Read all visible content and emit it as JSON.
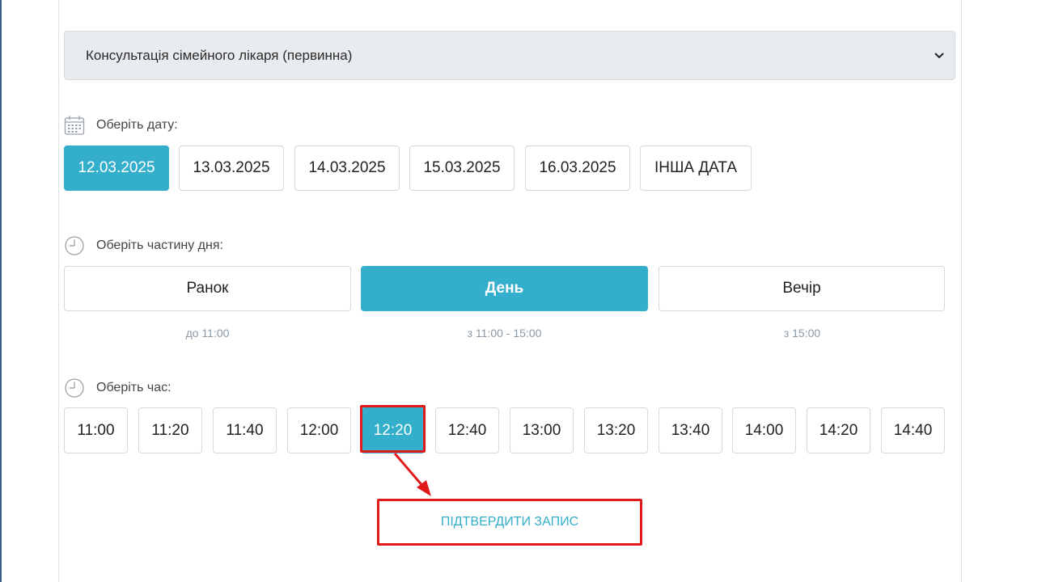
{
  "service": {
    "selected": "Консультація сімейного лікаря (первинна)"
  },
  "date_section": {
    "label": "Оберіть дату:",
    "dates": [
      "12.03.2025",
      "13.03.2025",
      "14.03.2025",
      "15.03.2025",
      "16.03.2025",
      "ІНША ДАТА"
    ],
    "selected_index": 0
  },
  "part_section": {
    "label": "Оберіть частину дня:",
    "parts": [
      {
        "label": "Ранок",
        "range": "до 11:00"
      },
      {
        "label": "День",
        "range": "з 11:00 - 15:00"
      },
      {
        "label": "Вечір",
        "range": "з 15:00"
      }
    ],
    "selected_index": 1
  },
  "time_section": {
    "label": "Оберіть час:",
    "times": [
      "11:00",
      "11:20",
      "11:40",
      "12:00",
      "12:20",
      "12:40",
      "13:00",
      "13:20",
      "13:40",
      "14:00",
      "14:20",
      "14:40"
    ],
    "selected_index": 4
  },
  "confirm": {
    "label": "ПІДТВЕРДИТИ ЗАПИС"
  },
  "colors": {
    "accent": "#33aecb",
    "highlight": "#e01a1a",
    "select_bg": "#e9ecef"
  },
  "icons": {
    "date": "calendar-icon",
    "part": "clock-icon",
    "time": "clock-icon",
    "select": "chevron-down-icon"
  }
}
